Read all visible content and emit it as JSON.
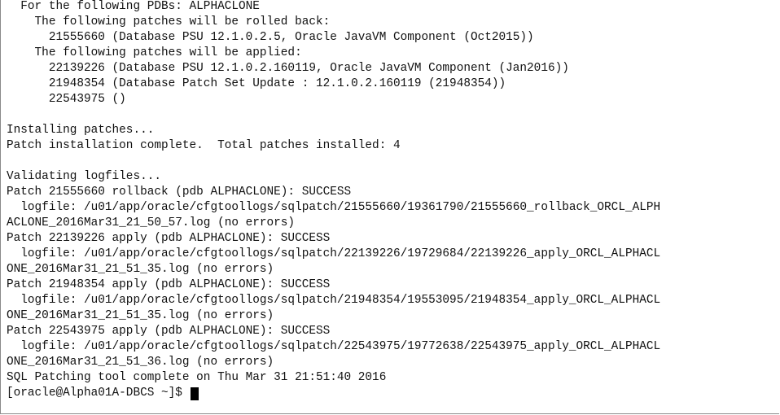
{
  "terminal": {
    "lines": [
      "  For the following PDBs: ALPHACLONE",
      "    The following patches will be rolled back:",
      "      21555660 (Database PSU 12.1.0.2.5, Oracle JavaVM Component (Oct2015))",
      "    The following patches will be applied:",
      "      22139226 (Database PSU 12.1.0.2.160119, Oracle JavaVM Component (Jan2016))",
      "      21948354 (Database Patch Set Update : 12.1.0.2.160119 (21948354))",
      "      22543975 ()",
      "",
      "Installing patches...",
      "Patch installation complete.  Total patches installed: 4",
      "",
      "Validating logfiles...",
      "Patch 21555660 rollback (pdb ALPHACLONE): SUCCESS",
      "  logfile: /u01/app/oracle/cfgtoollogs/sqlpatch/21555660/19361790/21555660_rollback_ORCL_ALPH",
      "ACLONE_2016Mar31_21_50_57.log (no errors)",
      "Patch 22139226 apply (pdb ALPHACLONE): SUCCESS",
      "  logfile: /u01/app/oracle/cfgtoollogs/sqlpatch/22139226/19729684/22139226_apply_ORCL_ALPHACL",
      "ONE_2016Mar31_21_51_35.log (no errors)",
      "Patch 21948354 apply (pdb ALPHACLONE): SUCCESS",
      "  logfile: /u01/app/oracle/cfgtoollogs/sqlpatch/21948354/19553095/21948354_apply_ORCL_ALPHACL",
      "ONE_2016Mar31_21_51_35.log (no errors)",
      "Patch 22543975 apply (pdb ALPHACLONE): SUCCESS",
      "  logfile: /u01/app/oracle/cfgtoollogs/sqlpatch/22543975/19772638/22543975_apply_ORCL_ALPHACL",
      "ONE_2016Mar31_21_51_36.log (no errors)",
      "SQL Patching tool complete on Thu Mar 31 21:51:40 2016"
    ],
    "prompt": "[oracle@Alpha01A-DBCS ~]$ "
  }
}
